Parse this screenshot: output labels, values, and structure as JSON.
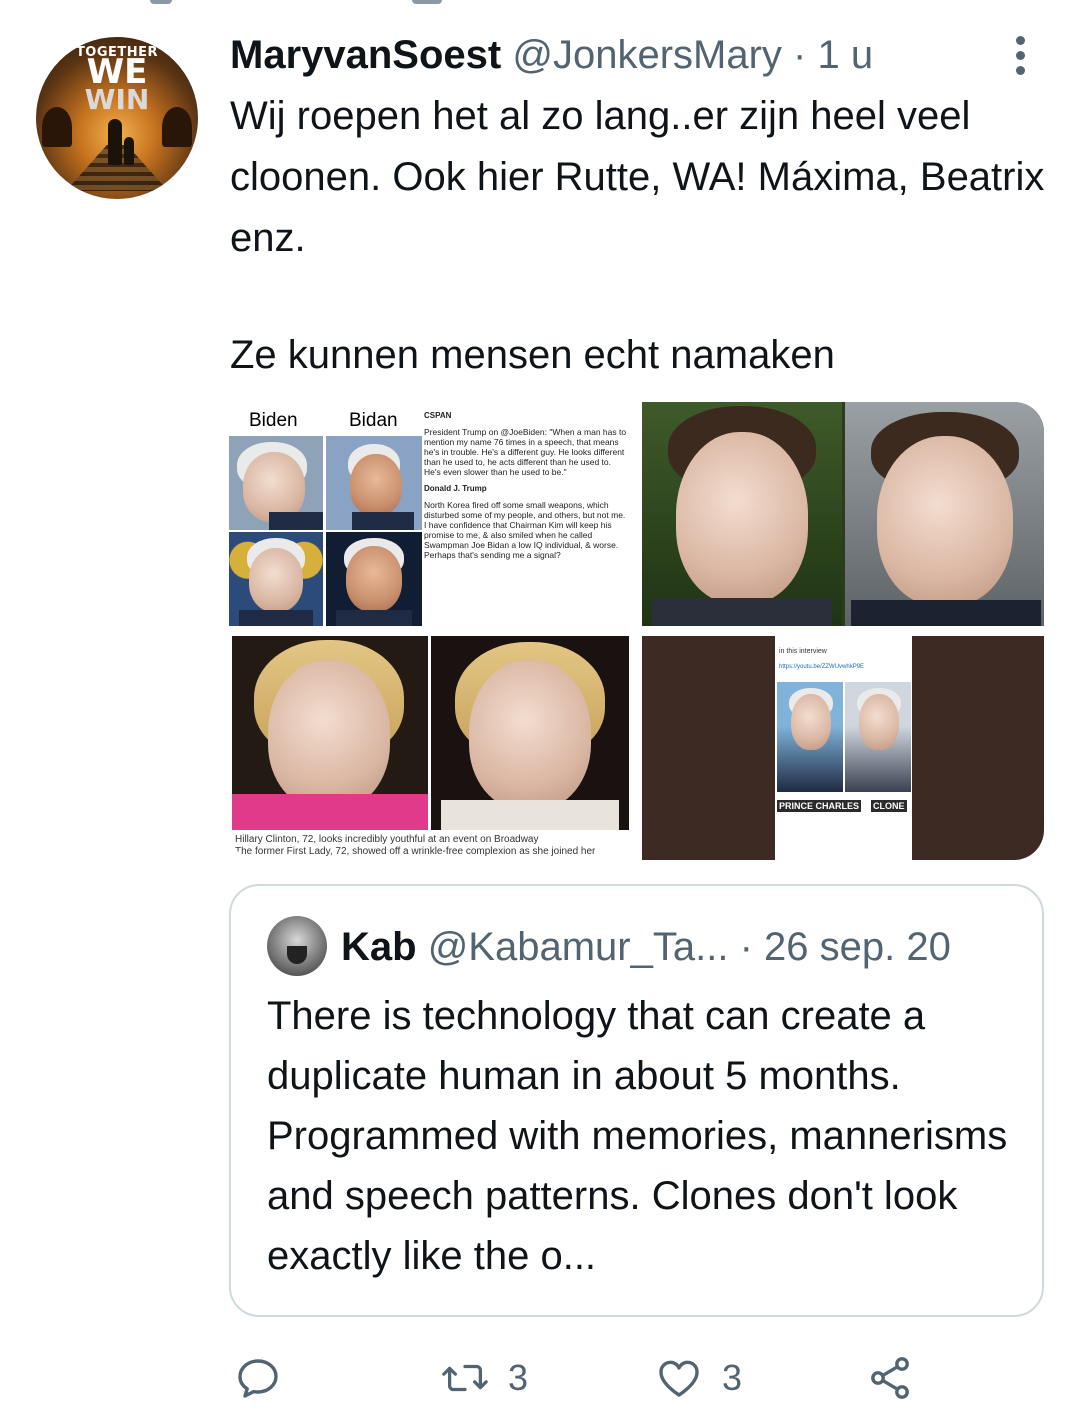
{
  "tweet": {
    "author_name": "MaryvanSoest",
    "author_handle": "@JonkersMary",
    "separator": "·",
    "time": "1 u",
    "text_line1": "Wij roepen het al zo lang..er zijn heel veel cloonen. Ook hier Rutte, WA! Máxima, Beatrix enz.",
    "text_line2": "Ze kunnen mensen echt namaken",
    "avatar_text": [
      "TOGETHER",
      "WE",
      "WIN"
    ]
  },
  "media": {
    "panel1": {
      "label_left": "Biden",
      "label_right": "Bidan",
      "mini_tweet_1": "President Trump on @JoeBiden: \"When a man has to mention my name 76 times in a speech, that means he's in trouble. He's a different guy. He looks different than he used to, he acts different than he used to. He's even slower than he used to be.\"",
      "mini_author_1": "CSPAN",
      "mini_author_2": "Donald J. Trump",
      "mini_tweet_2": "North Korea fired off some small weapons, which disturbed some of my people, and others, but not me. I have confidence that Chairman Kim will keep his promise to me, & also smiled when he called Swampman Joe Bidan a low IQ individual, & worse. Perhaps that's sending me a signal?"
    },
    "panel3": {
      "caption": "Hillary Clinton, 72, looks incredibly youthful at an event on Broadway",
      "caption2": "The former First Lady, 72, showed off a wrinkle-free complexion as she joined her"
    },
    "panel4": {
      "label_left": "PRINCE CHARLES",
      "label_right": "CLONE",
      "link": "https://youtu.be/ZZWUvwhkP9E",
      "intro": "in this interview"
    }
  },
  "quote": {
    "author_name": "Kab",
    "author_handle": "@Kabamur_Ta...",
    "date": "· 26 sep. 20",
    "text": "There is technology that can create a duplicate human in about 5 months. Programmed with memories, mannerisms and speech patterns. Clones don't look exactly like the o..."
  },
  "actions": {
    "reply_icon": "reply-icon",
    "retweet_icon": "retweet-icon",
    "retweet_count": "3",
    "like_icon": "heart-icon",
    "like_count": "3",
    "share_icon": "share-icon"
  },
  "colors": {
    "text_primary": "#0f1419",
    "text_secondary": "#536471",
    "border": "#cfd9de"
  }
}
